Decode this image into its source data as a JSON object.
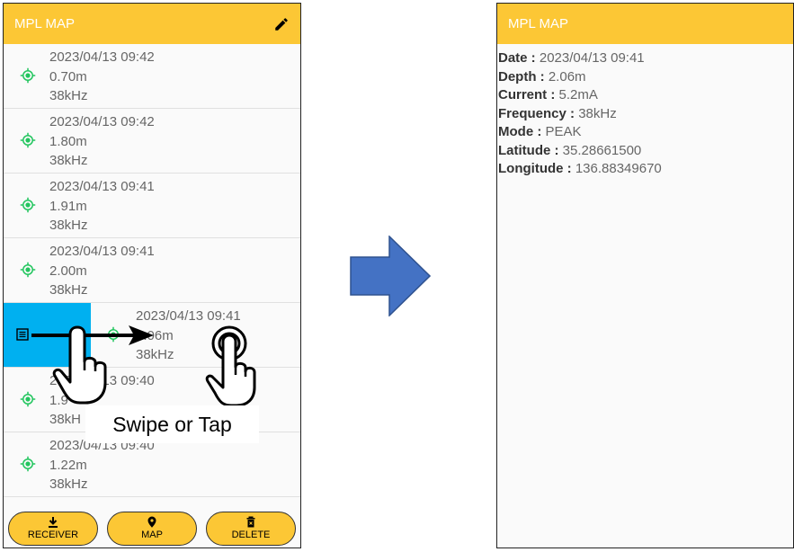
{
  "left_screen": {
    "title": "MPL MAP",
    "items": [
      {
        "date": "2023/04/13 09:42",
        "depth": "0.70m",
        "freq": "38kHz"
      },
      {
        "date": "2023/04/13 09:42",
        "depth": "1.80m",
        "freq": "38kHz"
      },
      {
        "date": "2023/04/13 09:41",
        "depth": "1.91m",
        "freq": "38kHz"
      },
      {
        "date": "2023/04/13 09:41",
        "depth": "2.00m",
        "freq": "38kHz"
      },
      {
        "date": "2023/04/13 09:41",
        "depth": "2.06m",
        "freq": "38kHz"
      },
      {
        "date": "2023/04/13 09:40",
        "depth": "1.9",
        "freq": "38kH"
      },
      {
        "date": "2023/04/13 09:40",
        "depth": "1.22m",
        "freq": "38kHz"
      }
    ],
    "buttons": {
      "receiver": "RECEIVER",
      "map": "MAP",
      "delete": "DELETE"
    }
  },
  "right_screen": {
    "title": "MPL MAP",
    "fields": [
      {
        "label": "Date :",
        "value": "2023/04/13 09:41"
      },
      {
        "label": "Depth :",
        "value": "2.06m"
      },
      {
        "label": "Current :",
        "value": "5.2mA"
      },
      {
        "label": "Frequency :",
        "value": "38kHz"
      },
      {
        "label": "Mode :",
        "value": "PEAK"
      },
      {
        "label": "Latitude :",
        "value": "35.28661500"
      },
      {
        "label": "Longitude :",
        "value": "136.88349670"
      }
    ]
  },
  "overlay": {
    "caption": "Swipe or Tap"
  },
  "colors": {
    "appbar": "#fcc735",
    "arrow": "#4472c4",
    "swipe": "#00b0f0",
    "location_icon": "#22c55e"
  },
  "icons": [
    "edit-icon",
    "location-icon",
    "details-icon",
    "download-icon",
    "map-pin-icon",
    "trash-icon"
  ]
}
